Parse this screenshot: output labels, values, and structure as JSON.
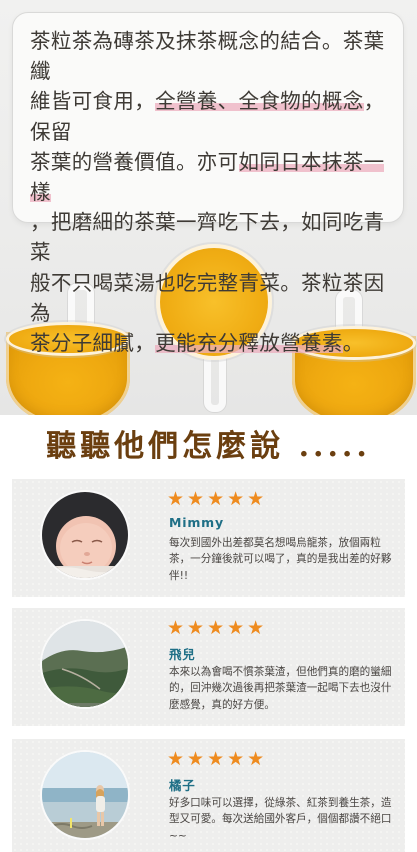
{
  "intro": {
    "line1": "茶粒茶為磚茶及抹茶概念的結合。茶葉纖",
    "line2_a": "維皆可食用，",
    "line2_b": "全營養、全食物的概念",
    "line2_c": "，保留",
    "line3_a": "茶葉的營養價值。亦可",
    "line3_b": "如同日本抹茶一樣",
    "line4": "，把磨細的茶葉一齊吃下去，如同吃青菜",
    "line5": "般不只喝菜湯也吃完整青菜。茶粒茶因為",
    "line6_a": "茶分子細膩，",
    "line6_b": "更能充分釋放營養素",
    "line6_c": "。"
  },
  "reviews_title": "聽聽他們怎麼說 .....",
  "reviews": [
    {
      "stars": "★★★★★",
      "name": "Mimmy",
      "text": "每次到國外出差都莫名想喝烏龍茶，放個兩粒茶，一分鐘後就可以喝了，真的是我出差的好夥伴!!",
      "avatar": "baby-photo"
    },
    {
      "stars": "★★★★★",
      "name": "飛兒",
      "text": "本來以為會喝不慣茶葉渣，但他們真的磨的蠻細的，回沖幾次過後再把茶葉渣一起喝下去也沒什麼感覺，真的好方便。",
      "avatar": "landscape-photo"
    },
    {
      "stars": "★★★★★",
      "name": "橘子",
      "text": "好多口味可以選擇，從綠茶、紅茶到養生茶，造型又可愛。每次送給國外客戶，個個都讚不絕口~~",
      "avatar": "beach-photo"
    }
  ],
  "colors": {
    "tea": "#f0ab12",
    "title_brown": "#6b3f10",
    "star": "#ee8b1f",
    "name_teal": "#1f6f86",
    "highlight": "#ecaebe"
  }
}
